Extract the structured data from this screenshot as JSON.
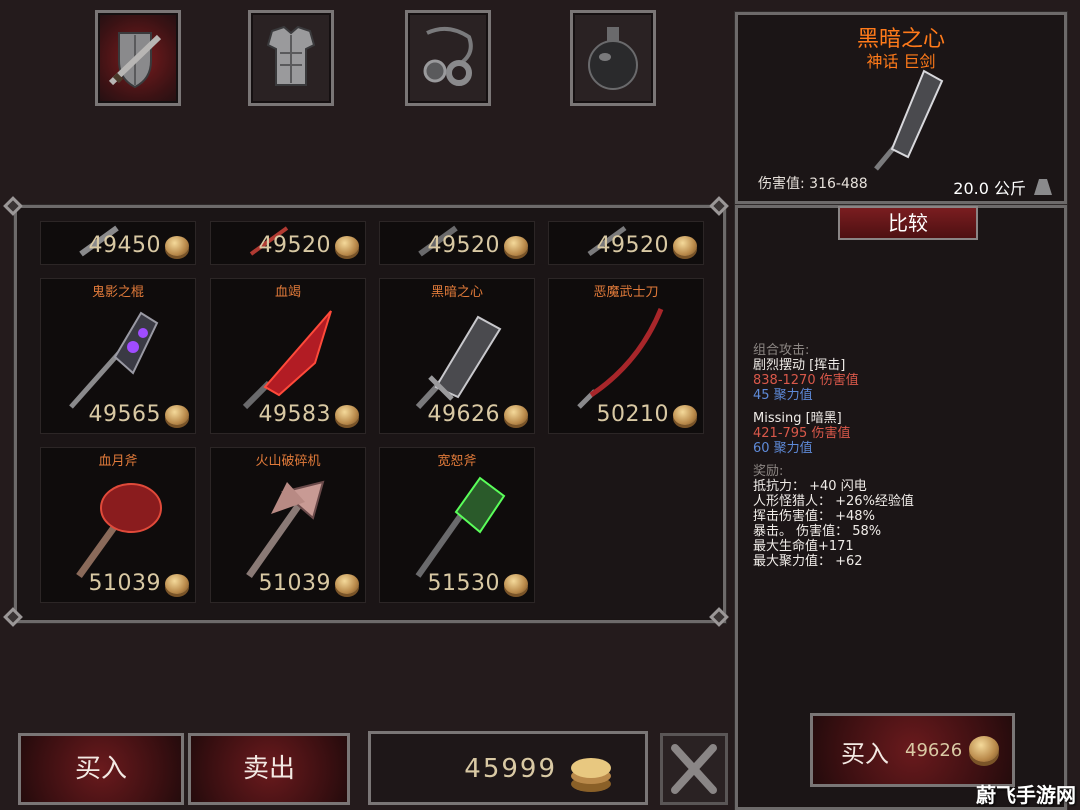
{
  "categories": [
    {
      "name": "weapon",
      "icon": "sword-shield-icon",
      "active": true
    },
    {
      "name": "armor",
      "icon": "chest-armor-icon",
      "active": false
    },
    {
      "name": "accessory",
      "icon": "amulet-ring-icon",
      "active": false
    },
    {
      "name": "potion",
      "icon": "potion-flask-icon",
      "active": false
    }
  ],
  "items_top_row": [
    {
      "price": "49450"
    },
    {
      "price": "49520"
    },
    {
      "price": "49520"
    },
    {
      "price": "49520"
    }
  ],
  "items": [
    {
      "name": "鬼影之棍",
      "price": "49565",
      "icon": "purple-mace-icon"
    },
    {
      "name": "血竭",
      "price": "49583",
      "icon": "red-blade-icon"
    },
    {
      "name": "黑暗之心",
      "price": "49626",
      "icon": "dark-greatsword-icon"
    },
    {
      "name": "恶魔武士刀",
      "price": "50210",
      "icon": "katana-icon"
    },
    {
      "name": "血月斧",
      "price": "51039",
      "icon": "red-axe-icon"
    },
    {
      "name": "火山破碎机",
      "price": "51039",
      "icon": "double-axe-icon"
    },
    {
      "name": "宽恕斧",
      "price": "51530",
      "icon": "green-axe-icon"
    }
  ],
  "detail": {
    "name": "黑暗之心",
    "subtitle": "神话 巨剑",
    "damage": "伤害值: 316-488",
    "weight": "20.0 公斤",
    "compare_label": "比较"
  },
  "stats": {
    "combo_header": "组合攻击:",
    "combo1_name": "剧烈摆动 [挥击]",
    "combo1_damage": "838-1270 伤害值",
    "combo1_focus": "45 聚力值",
    "combo2_name": "Missing [暗黑]",
    "combo2_damage": "421-795 伤害值",
    "combo2_focus": "60 聚力值",
    "bonus_header": "奖励:",
    "bonus": [
      "抵抗力：  +40 闪电",
      "人形怪猎人：  +26%经验值",
      "挥击伤害值：  +48%",
      "暴击。 伤害值：  58%",
      "最大生命值+171",
      "最大聚力值：  +62"
    ]
  },
  "controls": {
    "buy_label": "买入",
    "sell_label": "卖出",
    "gold": "45999",
    "buy_big_label": "买入",
    "buy_big_price": "49626"
  },
  "watermark": "蔚飞手游网",
  "colors": {
    "accent_red": "#7a1d20",
    "item_name_orange": "#e07a3a",
    "legendary_title": "#ff7a1a",
    "damage_red": "#d9584a",
    "focus_blue": "#5e8ad8",
    "price_gold": "#d9c9a4"
  }
}
